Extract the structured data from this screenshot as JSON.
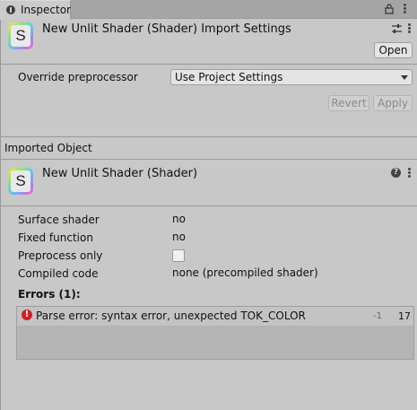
{
  "window": {
    "tab_label": "Inspector"
  },
  "header": {
    "icon_letter": "S",
    "title": "New Unlit Shader (Shader) Import Settings",
    "open_button": "Open"
  },
  "import_settings": {
    "override_label": "Override preprocessor",
    "override_value": "Use Project Settings",
    "revert_button": "Revert",
    "apply_button": "Apply"
  },
  "imported_object": {
    "section_title": "Imported Object",
    "icon_letter": "S",
    "title": "New Unlit Shader (Shader)",
    "help_icon": "?"
  },
  "properties": [
    {
      "label": "Surface shader",
      "value": "no"
    },
    {
      "label": "Fixed function",
      "value": "no"
    },
    {
      "label": "Preprocess only",
      "value": ""
    },
    {
      "label": "Compiled code",
      "value": "none (precompiled shader)"
    }
  ],
  "errors": {
    "heading": "Errors (1):",
    "items": [
      {
        "message": "Parse error: syntax error, unexpected TOK_COLOR",
        "platform": "-1",
        "line": "17"
      }
    ]
  },
  "colors": {
    "error_red": "#d31f1f",
    "panel_bg": "#c8c8c8"
  }
}
